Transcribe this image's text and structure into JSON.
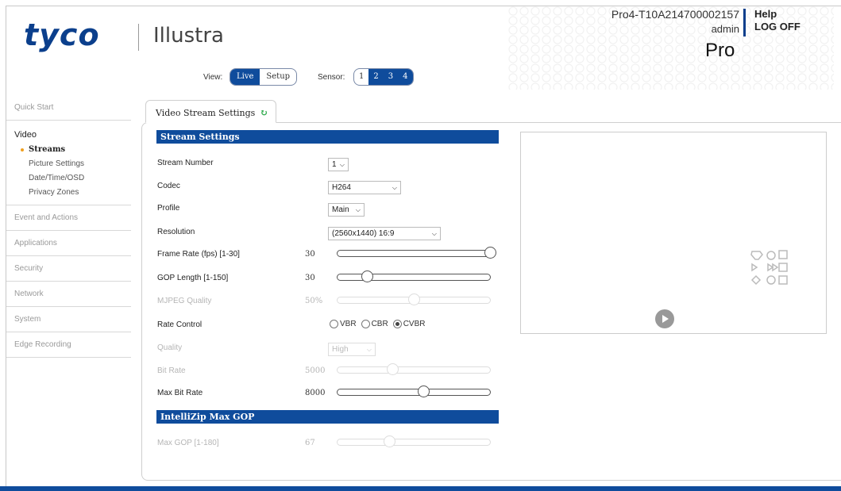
{
  "header": {
    "brand": "tyco",
    "product": "Illustra",
    "device_id": "Pro4-T10A214700002157",
    "user": "admin",
    "help": "Help",
    "logoff": "LOG OFF",
    "model": "Pro"
  },
  "view": {
    "label": "View:",
    "options": [
      "Live",
      "Setup"
    ],
    "selected": "Live"
  },
  "sensor": {
    "label": "Sensor:",
    "options": [
      "1",
      "2",
      "3",
      "4"
    ],
    "selected": [
      "2",
      "3",
      "4"
    ]
  },
  "sidebar": {
    "quick_start": "Quick Start",
    "video": "Video",
    "video_items": [
      "Streams",
      "Picture Settings",
      "Date/Time/OSD",
      "Privacy Zones"
    ],
    "active_item": "Streams",
    "event": "Event and Actions",
    "applications": "Applications",
    "security": "Security",
    "network": "Network",
    "system": "System",
    "edge": "Edge Recording"
  },
  "tab": {
    "label": "Video Stream Settings"
  },
  "stream_settings": {
    "header": "Stream Settings",
    "stream_number": {
      "label": "Stream Number",
      "value": "1"
    },
    "codec": {
      "label": "Codec",
      "value": "H264"
    },
    "profile": {
      "label": "Profile",
      "value": "Main"
    },
    "resolution": {
      "label": "Resolution",
      "value": "(2560x1440) 16:9"
    },
    "frame_rate": {
      "label": "Frame Rate (fps) [1-30]",
      "value": "30",
      "min": 1,
      "max": 30
    },
    "gop": {
      "label": "GOP Length [1-150]",
      "value": "30",
      "min": 1,
      "max": 150
    },
    "mjpeg": {
      "label": "MJPEG Quality",
      "value": "50%",
      "fraction": 0.5
    },
    "rate_control": {
      "label": "Rate Control",
      "options": [
        "VBR",
        "CBR",
        "CVBR"
      ],
      "selected": "CVBR"
    },
    "quality": {
      "label": "Quality",
      "value": "High"
    },
    "bit_rate": {
      "label": "Bit Rate",
      "value": "5000",
      "fraction": 0.36
    },
    "max_bit_rate": {
      "label": "Max Bit Rate",
      "value": "8000",
      "fraction": 0.56
    }
  },
  "intellizip": {
    "header": "IntelliZip Max GOP",
    "max_gop": {
      "label": "Max GOP [1-180]",
      "value": "67",
      "fraction": 0.34
    }
  },
  "colors": {
    "brand": "#0b3f8c",
    "accent": "#0f4c9c",
    "refresh": "#2eaa4c",
    "active_dot": "#f0a020"
  }
}
